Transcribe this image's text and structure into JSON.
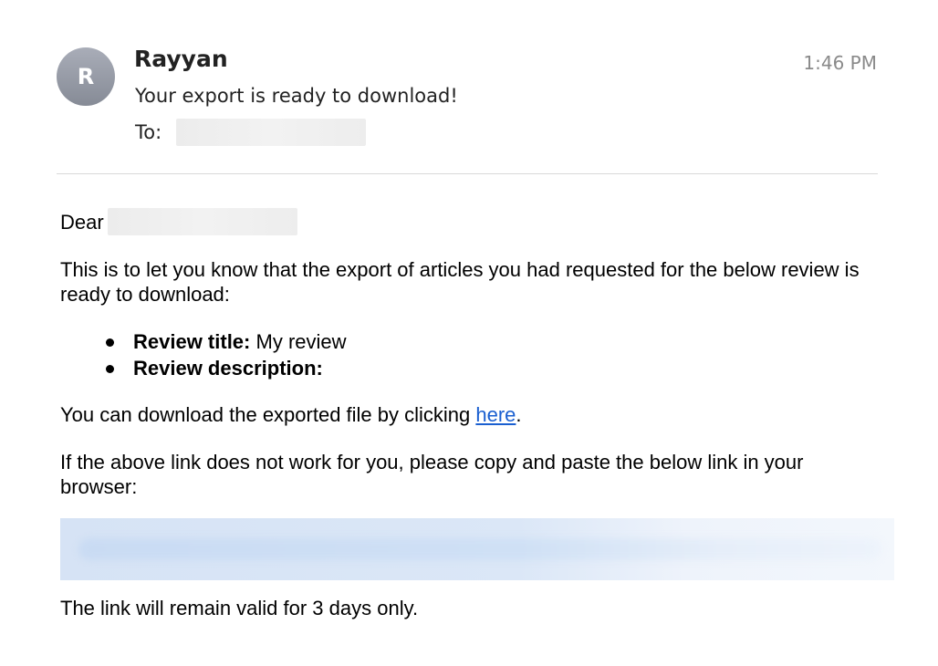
{
  "email": {
    "sender_initial": "R",
    "sender_name": "Rayyan",
    "time": "1:46 PM",
    "subject": "Your export is ready to download!",
    "to_label": "To:"
  },
  "body": {
    "greeting": "Dear",
    "intro": "This is to let you know that the export of articles you had requested for the below review is ready to download:",
    "bullets": [
      {
        "label": "Review title:",
        "value": "My review"
      },
      {
        "label": "Review description:",
        "value": ""
      }
    ],
    "download_prefix": "You can download the exported file by clicking ",
    "download_link": "here",
    "download_suffix": ".",
    "fallback": "If the above link does not work for you, please copy and paste the below link in your browser:",
    "validity": "The link will remain valid for 3 days only."
  },
  "colors": {
    "link": "#1a5fd0",
    "avatar": "#8e929c",
    "time": "#8a8a8a"
  }
}
